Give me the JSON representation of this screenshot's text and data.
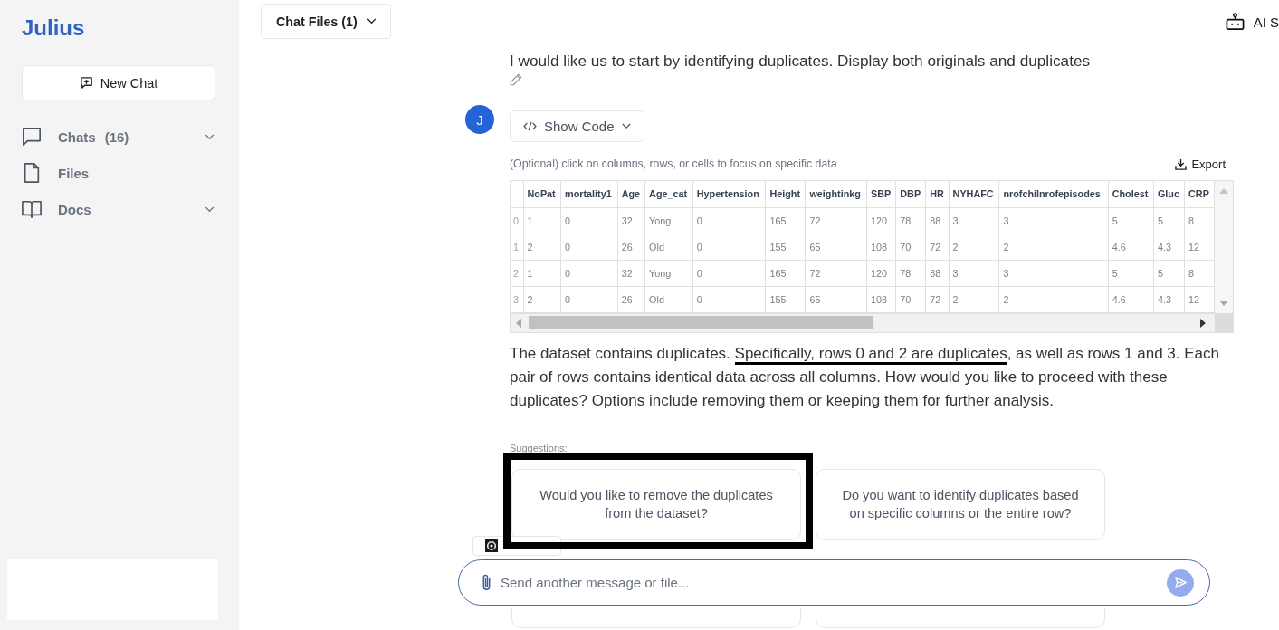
{
  "sidebar": {
    "logo": "Julius",
    "new_chat_button": "New Chat",
    "items": [
      {
        "kind": "chats",
        "label": "Chats",
        "count": "(16)",
        "has_submenu": true
      },
      {
        "kind": "files",
        "label": "Files",
        "has_submenu": false
      },
      {
        "kind": "docs",
        "label": "Docs",
        "has_submenu": true
      }
    ]
  },
  "top_bar": {
    "chat_files_button": "Chat Files (1)",
    "assistant_settings": "AI S"
  },
  "user_message": {
    "text": "I would like us to start by identifying duplicates. Display both originals and duplicates"
  },
  "assistant_message": {
    "avatar": "J",
    "show_code_button": "Show Code",
    "table_hint": "(Optional) click on columns, rows, or cells to focus on specific data",
    "export_button": "Export",
    "table": {
      "columns": [
        "NoPat",
        "mortality1",
        "Age",
        "Age_cat",
        "Hypertension",
        "Height",
        "weightinkg",
        "SBP",
        "DBP",
        "HR",
        "NYHAFC",
        "nrofchilnrofepisodes",
        "Cholest",
        "Gluc",
        "CRP"
      ],
      "rows": [
        {
          "index": "0",
          "cells": [
            "1",
            "0",
            "32",
            "Yong",
            "0",
            "165",
            "72",
            "120",
            "78",
            "88",
            "3",
            "3",
            "5",
            "5",
            "8"
          ]
        },
        {
          "index": "1",
          "cells": [
            "2",
            "0",
            "26",
            "Old",
            "0",
            "155",
            "65",
            "108",
            "70",
            "72",
            "2",
            "2",
            "4.6",
            "4.3",
            "12"
          ]
        },
        {
          "index": "2",
          "cells": [
            "1",
            "0",
            "32",
            "Yong",
            "0",
            "165",
            "72",
            "120",
            "78",
            "88",
            "3",
            "3",
            "5",
            "5",
            "8"
          ]
        },
        {
          "index": "3",
          "cells": [
            "2",
            "0",
            "26",
            "Old",
            "0",
            "155",
            "65",
            "108",
            "70",
            "72",
            "2",
            "2",
            "4.6",
            "4.3",
            "12"
          ]
        }
      ]
    },
    "answer": [
      {
        "text": "The dataset contains duplicates. ",
        "underlined": false
      },
      {
        "text": "Specifically, rows 0 and 2 are duplicates",
        "underlined": true
      },
      {
        "text": ", as well as rows 1 and 3. Each pair of rows contains identical data across all columns. How would you like to proceed with these duplicates? Options include removing them or keeping them for further analysis.",
        "underlined": false
      }
    ],
    "suggestions_label": "Suggestions:",
    "suggestions": [
      {
        "text": "Would you like to remove the duplicates from the dataset?",
        "highlighted": true
      },
      {
        "text": "Do you want to identify duplicates based on specific columns or the entire row?",
        "highlighted": false
      },
      {
        "highlighted": false
      },
      {
        "highlighted": false
      }
    ]
  },
  "composer": {
    "placeholder": "Send another message or file..."
  }
}
